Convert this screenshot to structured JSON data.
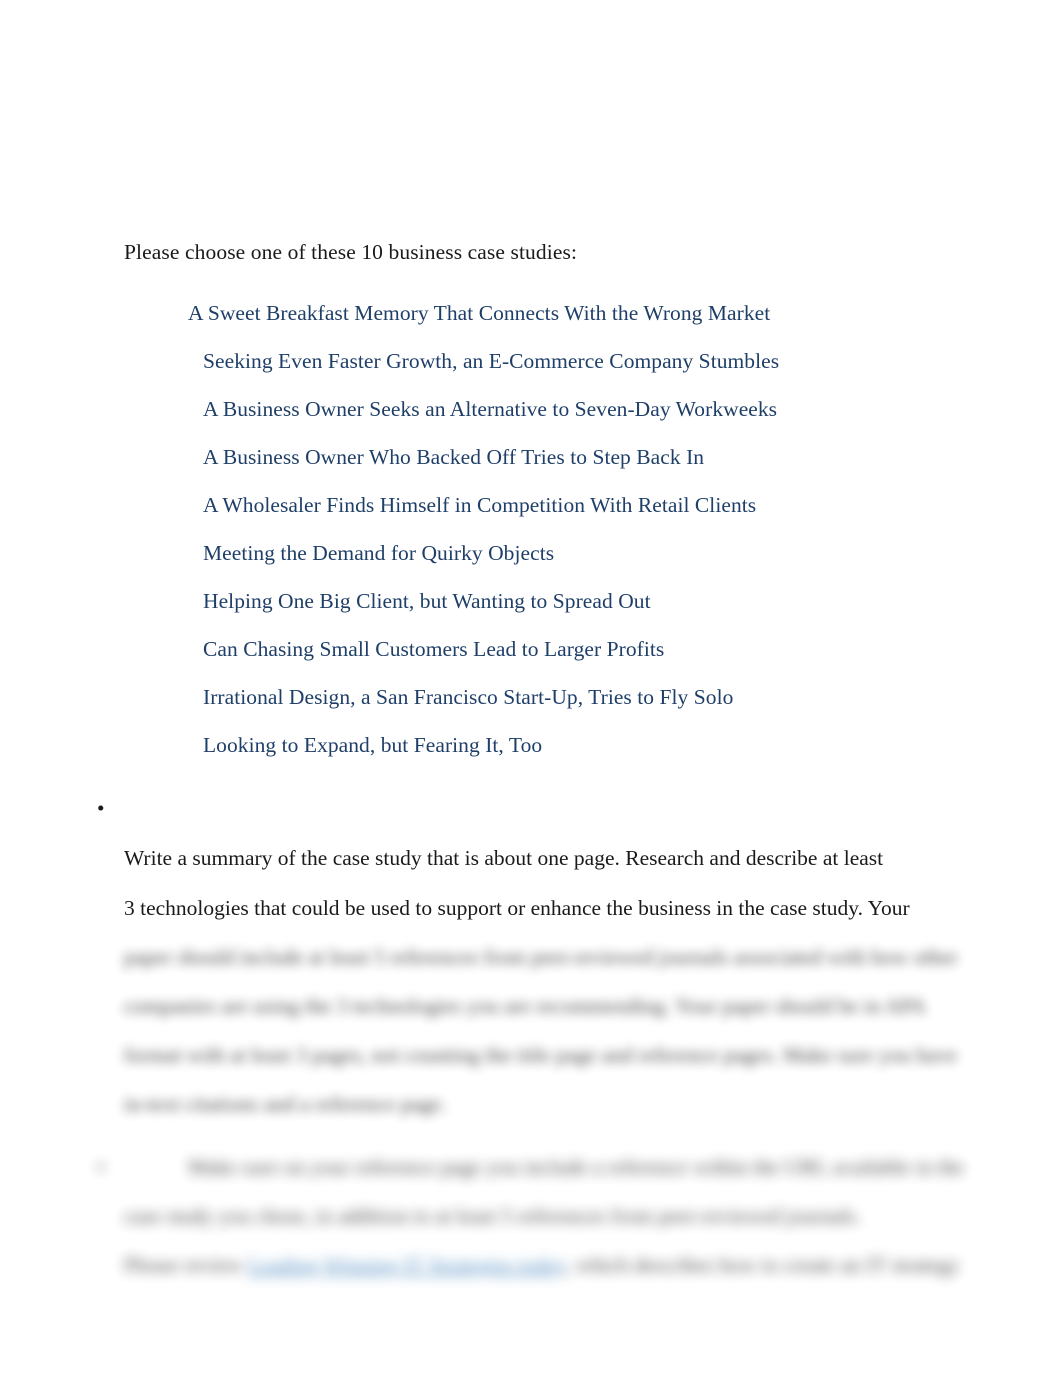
{
  "document": {
    "intro": "Please choose one of these 10 business case studies:",
    "case_studies": [
      "A Sweet Breakfast Memory That Connects With the Wrong Market",
      "Seeking Even Faster Growth, an E-Commerce Company Stumbles",
      "A Business Owner Seeks an Alternative to Seven-Day Workweeks",
      "A Business Owner Who Backed Off Tries to Step Back In",
      "A Wholesaler Finds Himself in Competition With Retail Clients",
      "Meeting the Demand for Quirky Objects",
      "Helping One Big Client, but Wanting to Spread Out",
      "Can Chasing Small Customers Lead to Larger Profits",
      "Irrational Design, a San Francisco Start-Up, Tries to Fly Solo",
      "Looking to Expand, but Fearing It, Too"
    ],
    "bullets": [
      {
        "marker": "•",
        "lines": [
          "Write a summary of the case study that is about one page. Research and describe at least",
          "3 technologies that could be used to support or enhance the business in the case study. Your"
        ],
        "blurred_lines": [
          "paper should include at least 5 references from peer-reviewed journals associated with how other",
          "companies are using the 3 technologies you are recommending. Your paper should be in APA",
          "format with at least 3 pages, not counting the title page and reference pages. Make sure you have",
          "in-text citations and a reference page."
        ]
      },
      {
        "marker": "•",
        "blurred_lines": [
          "Make sure on your reference page you include a reference within the URL available in the",
          "case study you chose, in addition to at least 5 references from peer-reviewed journals.",
          "Please review Leading Winning IT Strategies today, which describes how to create an IT strategy"
        ],
        "inline_link": {
          "prefix": "Please review ",
          "label": "Leading Winning IT Strategies today",
          "suffix": ", which describes how to create an IT strategy"
        }
      }
    ],
    "colors": {
      "case_link": "#1f3f68",
      "inline_link": "#2e74b5",
      "body_text": "#1a1a1a",
      "background": "#ffffff"
    }
  }
}
